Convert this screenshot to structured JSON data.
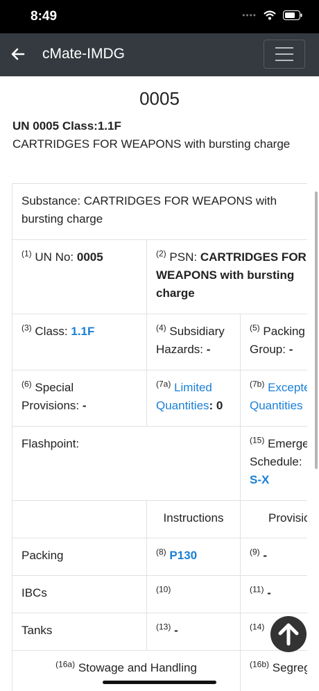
{
  "status": {
    "time": "8:49"
  },
  "nav": {
    "title": "cMate-IMDG"
  },
  "page": {
    "heading": "0005",
    "un_class": "UN 0005 Class:1.1F",
    "description": "CARTRIDGES FOR WEAPONS with bursting charge"
  },
  "table": {
    "substance": "Substance: CARTRIDGES FOR WEAPONS with bursting charge",
    "un_no": {
      "num": "(1)",
      "label": "UN No: ",
      "value": "0005"
    },
    "psn": {
      "num": "(2)",
      "label": "PSN: ",
      "value": "CARTRIDGES FOR WEAPONS with bursting charge"
    },
    "class": {
      "num": "(3)",
      "label": "Class: ",
      "value": "1.1F"
    },
    "subsidiary": {
      "num": "(4)",
      "label": "Subsidiary Hazards: ",
      "value": "-"
    },
    "packing_group": {
      "num": "(5)",
      "label": "Packing Group: ",
      "value": "-"
    },
    "special": {
      "num": "(6)",
      "label": "Special Provisions: ",
      "value": "-"
    },
    "limited": {
      "num": "(7a)",
      "label": "Limited Quantities",
      "value": ": 0"
    },
    "excepted": {
      "num": "(7b)",
      "label": "Excepted Quantities"
    },
    "flashpoint": {
      "label": "Flashpoint:"
    },
    "ems": {
      "num": "(15)",
      "label": "Emergency Schedule:",
      "value": "S-X"
    },
    "headers": {
      "instructions": "Instructions",
      "provisions": "Provisions"
    },
    "rows": [
      {
        "label": "Packing",
        "instr_num": "(8)",
        "instr_val": "P130",
        "prov_num": "(9)",
        "prov_val": "-"
      },
      {
        "label": "IBCs",
        "instr_num": "(10)",
        "instr_val": "",
        "prov_num": "(11)",
        "prov_val": "-"
      },
      {
        "label": "Tanks",
        "instr_num": "(13)",
        "instr_val": "-",
        "prov_num": "(14)",
        "prov_val": ""
      }
    ],
    "stowage": {
      "num": "(16a)",
      "label": "Stowage and Handling"
    },
    "segregation": {
      "num": "(16b)",
      "label": "Segregation"
    }
  },
  "icons": {
    "back": "arrow-left-icon",
    "menu": "hamburger-icon",
    "scroll_top": "arrow-up-icon",
    "wifi": "wifi-icon",
    "battery": "battery-icon"
  }
}
